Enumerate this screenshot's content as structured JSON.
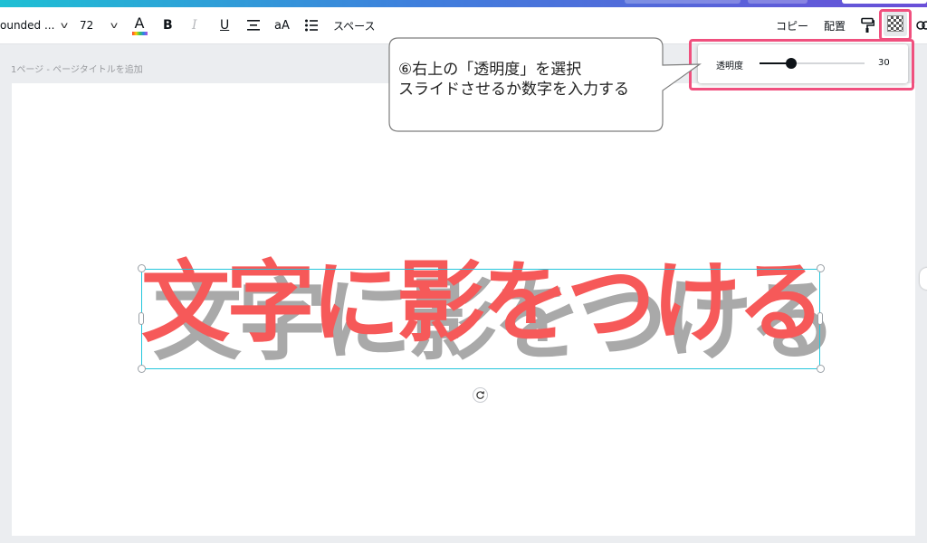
{
  "toolbar": {
    "font_name": "ounded ...",
    "font_size": "72",
    "bold_label": "B",
    "italic_label": "I",
    "underline_label": "U",
    "case_label": "aA",
    "spacing_label": "スペース",
    "copy_label": "コピー",
    "arrange_label": "配置",
    "text_color_label": "A",
    "chevron_icon": "chevron-down-icon",
    "align_icon": "align-center-icon",
    "list_icon": "bullet-list-icon",
    "paint_icon": "paint-roller-icon",
    "transparency_icon": "checkerboard-icon",
    "link_icon": "link-icon"
  },
  "page": {
    "title": "1ページ - ページタイトルを追加"
  },
  "transparency_panel": {
    "label": "透明度",
    "value": "30",
    "fraction": 0.3
  },
  "callout": {
    "line1": "⑥右上の「透明度」を選択",
    "line2": "スライドさせるか数字を入力する"
  },
  "canvas": {
    "heading": "文字に影をつける",
    "shadow_color": "#a9a9a9",
    "text_color": "#f65959",
    "rotate_icon": "rotate-icon"
  },
  "colors": {
    "highlight": "#f0507e",
    "selection": "#24c6dc"
  }
}
